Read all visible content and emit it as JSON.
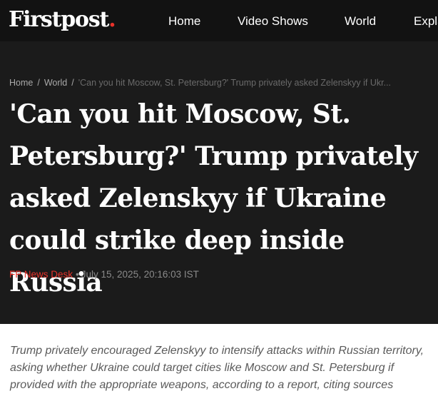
{
  "header": {
    "logo_text": "Firstpost",
    "logo_dot": ".",
    "nav": [
      {
        "label": "Home"
      },
      {
        "label": "Video Shows"
      },
      {
        "label": "World"
      },
      {
        "label": "Expla"
      }
    ]
  },
  "breadcrumb": {
    "items": [
      "Home",
      "World"
    ],
    "separator": "/",
    "current": "'Can you hit Moscow, St. Petersburg?' Trump privately asked Zelenskyy if Ukr..."
  },
  "article": {
    "headline": "'Can you hit Moscow, St. Petersburg?' Trump privately asked Zelenskyy if Ukraine could strike deep inside Russia",
    "author": "FP News Desk",
    "bullet": "•",
    "date": "July 15, 2025, 20:16:03 IST",
    "summary": "Trump privately encouraged Zelenskyy to intensify attacks within Russian territory, asking whether Ukraine could target cities like Moscow and St. Petersburg if provided with the appropriate weapons, according to a report, citing sources"
  },
  "colors": {
    "background_dark": "#1b1b1b",
    "topbar": "#121212",
    "accent_red": "#e8322a",
    "summary_text": "#5a5a5a"
  }
}
